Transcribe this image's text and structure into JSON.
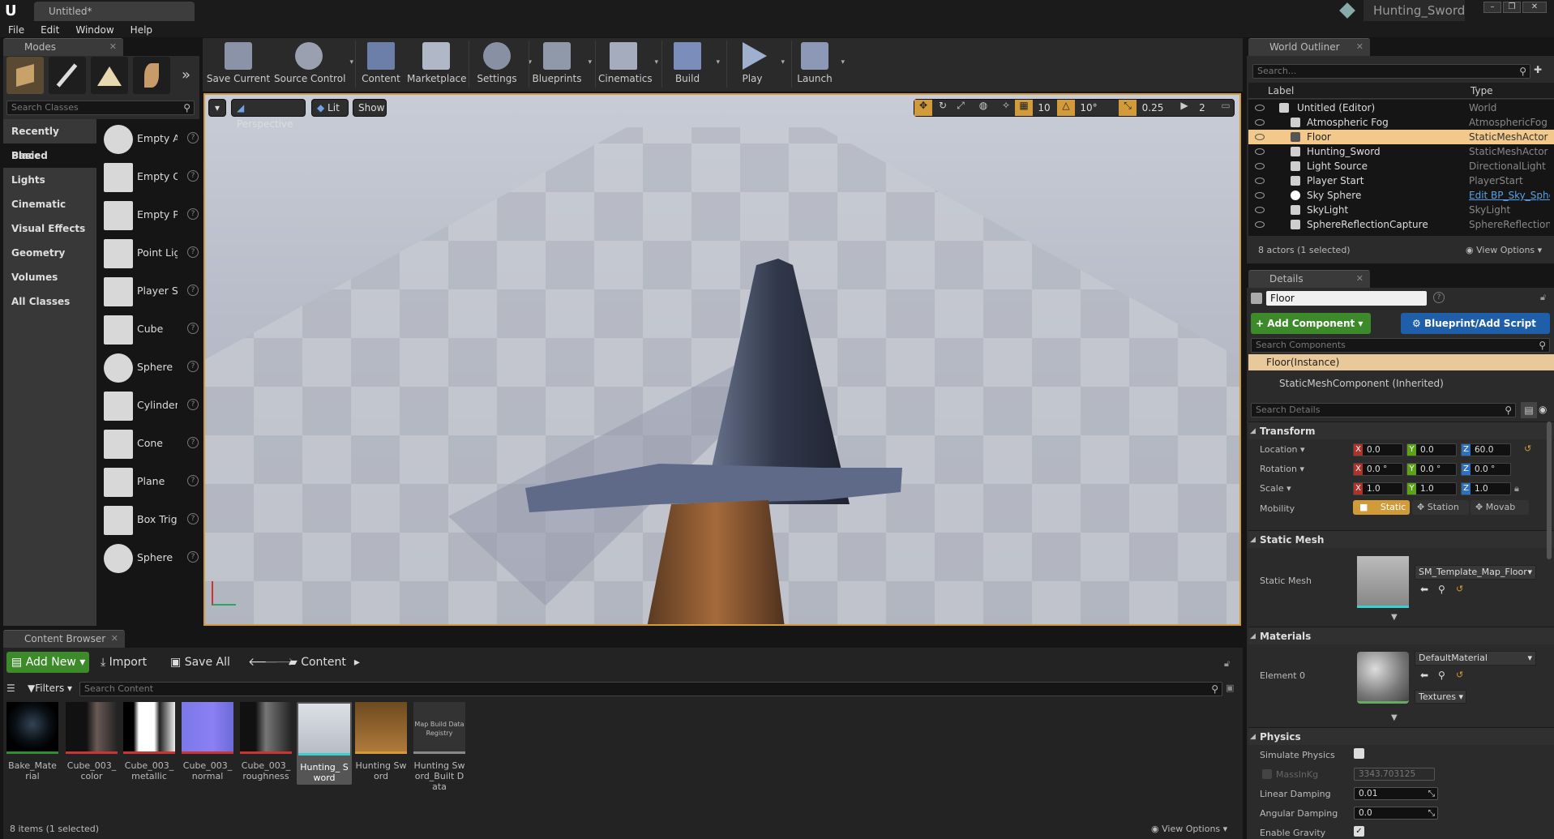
{
  "window": {
    "tab_title": "Untitled*",
    "project_name": "Hunting_Sword"
  },
  "menu": [
    "File",
    "Edit",
    "Window",
    "Help"
  ],
  "modes": {
    "tab_label": "Modes",
    "search_placeholder": "Search Classes",
    "categories": [
      "Recently Placed",
      "Basic",
      "Lights",
      "Cinematic",
      "Visual Effects",
      "Geometry",
      "Volumes",
      "All Classes"
    ],
    "selected_category": "Basic",
    "items": [
      "Empty A",
      "Empty C",
      "Empty P",
      "Point Lig",
      "Player S",
      "Cube",
      "Sphere",
      "Cylinder",
      "Cone",
      "Plane",
      "Box Trig",
      "Sphere "
    ]
  },
  "toolbar": {
    "buttons": [
      "Save Current",
      "Source Control",
      "Content",
      "Marketplace",
      "Settings",
      "Blueprints",
      "Cinematics",
      "Build",
      "Play",
      "Launch"
    ]
  },
  "viewport": {
    "perspective": "Perspective",
    "lit": "Lit",
    "show": "Show",
    "grid_snap": "10",
    "rot_snap": "10°",
    "scale_snap": "0.25",
    "camera_speed": "2"
  },
  "outliner": {
    "tab_label": "World Outliner",
    "search_placeholder": "Search...",
    "col_label": "Label",
    "col_type": "Type",
    "rows": [
      {
        "name": "Untitled (Editor)",
        "type": "World"
      },
      {
        "name": "Atmospheric Fog",
        "type": "AtmosphericFog"
      },
      {
        "name": "Floor",
        "type": "StaticMeshActor"
      },
      {
        "name": "Hunting_Sword",
        "type": "StaticMeshActor"
      },
      {
        "name": "Light Source",
        "type": "DirectionalLight"
      },
      {
        "name": "Player Start",
        "type": "PlayerStart"
      },
      {
        "name": "Sky Sphere",
        "type": "Edit BP_Sky_Sphe"
      },
      {
        "name": "SkyLight",
        "type": "SkyLight"
      },
      {
        "name": "SphereReflectionCapture",
        "type": "SphereReflectionC"
      }
    ],
    "status": "8 actors (1 selected)",
    "view_options": "View Options"
  },
  "details": {
    "tab_label": "Details",
    "actor_name": "Floor",
    "add_component": "Add Component",
    "blueprint_script": "Blueprint/Add Script",
    "search_components": "Search Components",
    "instance": "Floor(Instance)",
    "component": "StaticMeshComponent (Inherited)",
    "search_details": "Search Details",
    "transform": {
      "title": "Transform",
      "location_label": "Location",
      "rotation_label": "Rotation",
      "scale_label": "Scale",
      "mobility_label": "Mobility",
      "location": [
        "0.0",
        "0.0",
        "60.0"
      ],
      "rotation": [
        "0.0 °",
        "0.0 °",
        "0.0 °"
      ],
      "scale": [
        "1.0",
        "1.0",
        "1.0"
      ],
      "mobility": [
        "Static",
        "Station",
        "Movab"
      ]
    },
    "static_mesh": {
      "title": "Static Mesh",
      "label": "Static Mesh",
      "value": "SM_Template_Map_Floor"
    },
    "materials": {
      "title": "Materials",
      "label": "Element 0",
      "value": "DefaultMaterial",
      "textures": "Textures"
    },
    "physics": {
      "title": "Physics",
      "simulate": "Simulate Physics",
      "mass": "MassInKg",
      "mass_value": "3343.703125",
      "linear": "Linear Damping",
      "linear_value": "0.01",
      "angular": "Angular Damping",
      "angular_value": "0.0",
      "gravity": "Enable Gravity"
    }
  },
  "content_browser": {
    "tab_label": "Content Browser",
    "add_new": "Add New",
    "import": "Import",
    "save_all": "Save All",
    "path": "Content",
    "filters": "Filters",
    "search_placeholder": "Search Content",
    "assets": [
      "Bake_Material",
      "Cube_003_ color",
      "Cube_003_ metallic",
      "Cube_003_ normal",
      "Cube_003_ roughness",
      "Hunting_ Sword",
      "Hunting Sword",
      "Hunting Sword_Built Data"
    ],
    "map_registry_label": "Map Build Data Registry",
    "status": "8 items (1 selected)",
    "view_options": "View Options"
  },
  "colors": {
    "accent_orange": "#d29b3a",
    "green_button": "#3d8a2a",
    "blue_button": "#1f5ea8",
    "selected_row": "#f2c98b"
  }
}
